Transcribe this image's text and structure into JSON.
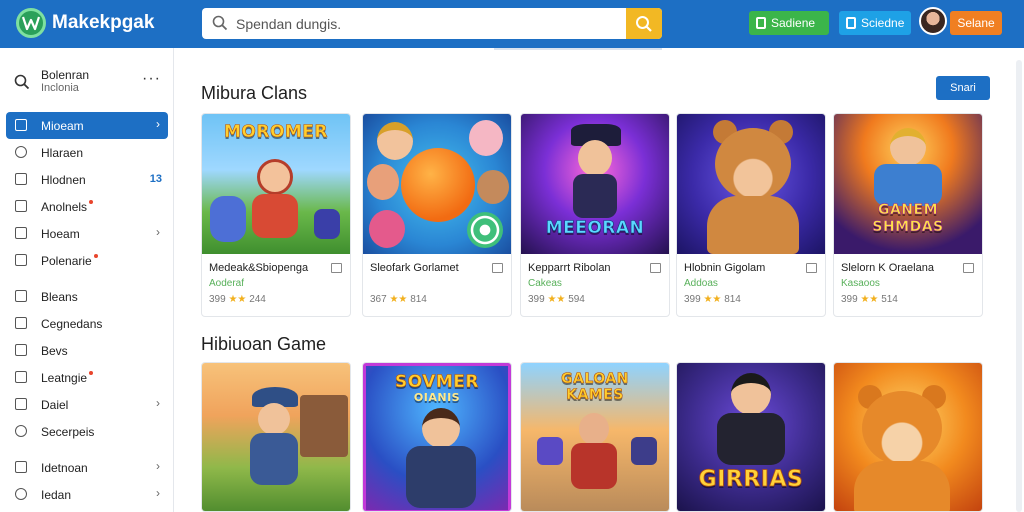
{
  "header": {
    "brand": "Makekpgak",
    "search_placeholder": "Spendan dungis.",
    "btn_green": "Sadiene",
    "btn_blue": "Sciedne",
    "btn_orange": "Selane",
    "colors": {
      "bar": "#1d6fc4",
      "search_button": "#f2b824",
      "green": "#3bb54a",
      "blue": "#1ea1e6",
      "orange": "#f07f22"
    }
  },
  "sidebar": {
    "profile_name": "Bolenran",
    "profile_sub": "Inclonia",
    "more": "···",
    "items": [
      {
        "label": "Mioeam",
        "icon": "triangle-icon",
        "active": true,
        "chevron": "›"
      },
      {
        "label": "Hlaraen",
        "icon": "circle-icon"
      },
      {
        "label": "Hlodnen",
        "icon": "flag-icon",
        "badge": "13"
      },
      {
        "label": "Anolnels",
        "icon": "document-icon",
        "dot": true
      },
      {
        "label": "Hoeam",
        "icon": "list-icon",
        "chevron": "›"
      },
      {
        "label": "Polenarie",
        "icon": "pen-icon",
        "dot": true
      },
      {
        "label": "Bleans",
        "icon": "grid-icon"
      },
      {
        "label": "Cegnedans",
        "icon": "window-icon"
      },
      {
        "label": "Bevs",
        "icon": "image-icon"
      },
      {
        "label": "Leatngie",
        "icon": "arrows-icon",
        "dot": true
      },
      {
        "label": "Daiel",
        "icon": "calendar-icon",
        "chevron": "›"
      },
      {
        "label": "Secerpeis",
        "icon": "ring-icon"
      },
      {
        "label": "Idetnoan",
        "icon": "user-icon",
        "chevron": "›"
      },
      {
        "label": "Iedan",
        "icon": "person-icon",
        "chevron": "›"
      }
    ]
  },
  "main": {
    "section1_title": "Mibura Clans",
    "see_all": "Snari",
    "section2_title": "Hibiuoan Game",
    "row1": [
      {
        "banner": "MOROMER",
        "name": "Medeak&Sbiopenga",
        "sub": "Aoderaf",
        "count": "399",
        "rating": "244"
      },
      {
        "banner": "",
        "name": "Sleofark Gorlamet",
        "sub": "",
        "count": "367",
        "rating": "814"
      },
      {
        "banner": "MEEORAN",
        "name": "Kepparrt Ribolan",
        "sub": "Cakeas",
        "count": "399",
        "rating": "594"
      },
      {
        "banner": "",
        "name": "Hlobnin Gigolam",
        "sub": "Addoas",
        "count": "399",
        "rating": "814"
      },
      {
        "banner": "GANEM SHMDAS",
        "name": "Slelorn K Oraelana",
        "sub": "Kasaoos",
        "count": "399",
        "rating": "514"
      }
    ],
    "row2": [
      {
        "banner": ""
      },
      {
        "banner": "SOVMER",
        "banner2": "OIANIS"
      },
      {
        "banner": "GALOAN KAMES"
      },
      {
        "banner": "GIRRIAS"
      },
      {
        "banner": ""
      }
    ]
  }
}
